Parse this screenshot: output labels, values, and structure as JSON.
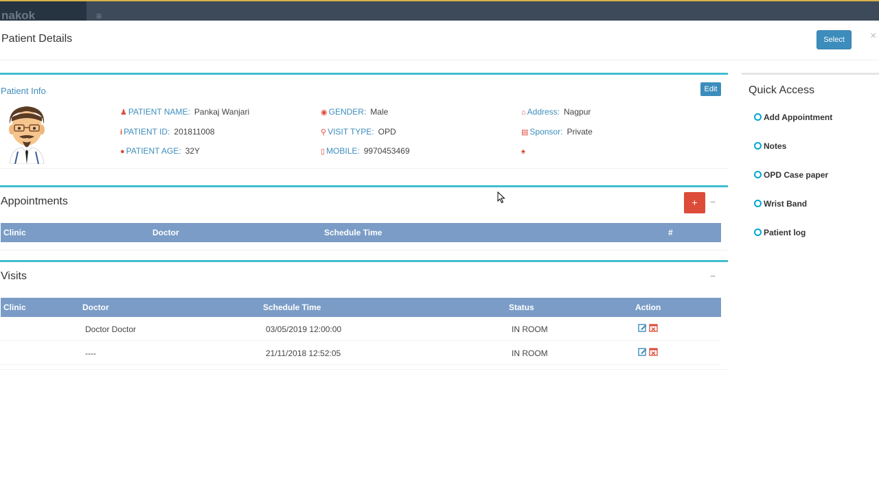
{
  "topbar": {
    "brand": "nakok",
    "menu_icon": "hamburger-icon"
  },
  "modal": {
    "title": "Patient Details",
    "select_label": "Select",
    "close_label": "×"
  },
  "patient_info": {
    "title": "Patient Info",
    "edit_label": "Edit",
    "fields": {
      "name": {
        "icon": "user-icon",
        "label": "PATIENT NAME:",
        "value": "Pankaj Wanjari"
      },
      "id": {
        "icon": "info-icon",
        "label": "PATIENT ID:",
        "value": "201811008"
      },
      "age": {
        "icon": "circle-icon",
        "label": "PATIENT AGE:",
        "value": "32Y"
      },
      "gender": {
        "icon": "target-icon",
        "label": "GENDER:",
        "value": "Male"
      },
      "visit_type": {
        "icon": "award-icon",
        "label": "VISIT TYPE:",
        "value": "OPD"
      },
      "mobile": {
        "icon": "mobile-icon",
        "label": "MOBILE:",
        "value": "9970453469"
      },
      "address": {
        "icon": "home-icon",
        "label": "Address:",
        "value": "Nagpur"
      },
      "sponsor": {
        "icon": "money-icon",
        "label": "Sponsor:",
        "value": "Private"
      },
      "doctor": {
        "icon": "user-md-icon"
      }
    }
  },
  "appointments": {
    "title": "Appointments",
    "add_label": "+",
    "collapse_label": "−",
    "columns": [
      "Clinic",
      "Doctor",
      "Schedule Time",
      "#"
    ]
  },
  "visits": {
    "title": "Visits",
    "collapse_label": "−",
    "columns": [
      "Clinic",
      "Doctor",
      "Schedule Time",
      "Status",
      "Action"
    ],
    "rows": [
      {
        "clinic": "",
        "doctor": "Doctor Doctor",
        "schedule": "03/05/2019 12:00:00",
        "status": "IN ROOM"
      },
      {
        "clinic": "",
        "doctor": "----",
        "schedule": "21/11/2018 12:52:05",
        "status": "IN ROOM"
      }
    ]
  },
  "quick_access": {
    "title": "Quick Access",
    "items": [
      "Add Appointment",
      "Notes",
      "OPD Case paper",
      "Wrist Band",
      "Patient log"
    ]
  },
  "colors": {
    "accent": "#3fbdcf",
    "primary": "#3c8dbc",
    "danger": "#dd4b39",
    "table_header": "#7a9cc6"
  }
}
